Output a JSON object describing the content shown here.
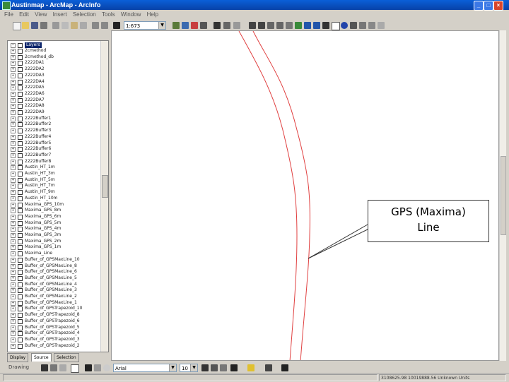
{
  "window": {
    "title": "Austinmap - ArcMap - ArcInfo",
    "buttons": {
      "minimize": "_",
      "maximize": "□",
      "close": "×"
    }
  },
  "menubar": {
    "items": [
      "File",
      "Edit",
      "View",
      "Insert",
      "Selection",
      "Tools",
      "Window",
      "Help"
    ]
  },
  "standard_toolbar": {
    "scale_value": "1:673"
  },
  "toc": {
    "root_label": "Layers",
    "layers": [
      "2cmethod",
      "2cmethod_db",
      "2222DA1",
      "2222DA2",
      "2222DA3",
      "2222DA4",
      "2222DA5",
      "2222DA6",
      "2222DA7",
      "2222DA8",
      "2222DA9",
      "2222Buffer1",
      "2222Buffer2",
      "2222Buffer3",
      "2222Buffer4",
      "2222Buffer5",
      "2222Buffer6",
      "2222Buffer7",
      "2222Buffer8",
      "Austin_HT_1m",
      "Austin_HT_3m",
      "Austin_HT_5m",
      "Austin_HT_7m",
      "Austin_HT_9m",
      "Austin_HT_10m",
      "Maxima_GPS_10m",
      "Maxima_GPS_8m",
      "Maxima_GPS_6m",
      "Maxima_GPS_5m",
      "Maxima_GPS_4m",
      "Maxima_GPS_3m",
      "Maxima_GPS_2m",
      "Maxima_GPS_1m",
      "Maxima_Line",
      "Buffer_of_GPSMaxLine_10",
      "Buffer_of_GPSMaxLine_8",
      "Buffer_of_GPSMaxLine_6",
      "Buffer_of_GPSMaxLine_5",
      "Buffer_of_GPSMaxLine_4",
      "Buffer_of_GPSMaxLine_3",
      "Buffer_of_GPSMaxLine_2",
      "Buffer_of_GPSMaxLine_1",
      "Buffer_of_GPSTrapezoid_10",
      "Buffer_of_GPSTrapezoid_8",
      "Buffer_of_GPSTrapezoid_6",
      "Buffer_of_GPSTrapezoid_5",
      "Buffer_of_GPSTrapezoid_4",
      "Buffer_of_GPSTrapezoid_3",
      "Buffer_of_GPSTrapezoid_2"
    ],
    "tabs": [
      "Display",
      "Source",
      "Selection"
    ]
  },
  "callout": {
    "line1": "GPS (Maxima)",
    "line2": "Line"
  },
  "drawing_toolbar": {
    "drawing_label": "Drawing",
    "font_value": "Arial",
    "font_size": "10"
  },
  "statusbar": {
    "coordinates": "3108625.98  10019888.56 Unknown Units"
  },
  "colors": {
    "line_red": "#e04040",
    "title_blue": "#0a5fd8",
    "callout_border": "#333333"
  }
}
